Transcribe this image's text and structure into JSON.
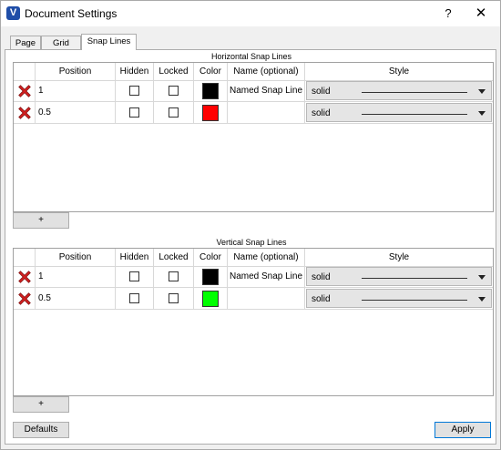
{
  "window": {
    "title": "Document Settings",
    "icon": "V",
    "help_label": "?",
    "close_label": "✕"
  },
  "tabs": [
    {
      "label": "Page",
      "active": false
    },
    {
      "label": "Grid",
      "active": false
    },
    {
      "label": "Snap Lines",
      "active": true
    }
  ],
  "columns": {
    "position": "Position",
    "hidden": "Hidden",
    "locked": "Locked",
    "color": "Color",
    "name": "Name (optional)",
    "style": "Style"
  },
  "horizontal": {
    "title": "Horizontal Snap Lines",
    "rows": [
      {
        "position": "1",
        "hidden": false,
        "locked": false,
        "color": "#000000",
        "name": "Named Snap Line",
        "style": "solid"
      },
      {
        "position": "0.5",
        "hidden": false,
        "locked": false,
        "color": "#ff0000",
        "name": "",
        "style": "solid"
      }
    ],
    "add_label": "+"
  },
  "vertical": {
    "title": "Vertical Snap Lines",
    "rows": [
      {
        "position": "1",
        "hidden": false,
        "locked": false,
        "color": "#000000",
        "name": "Named Snap Line",
        "style": "solid"
      },
      {
        "position": "0.5",
        "hidden": false,
        "locked": false,
        "color": "#00ff00",
        "name": "",
        "style": "solid"
      }
    ],
    "add_label": "+"
  },
  "footer": {
    "defaults_label": "Defaults",
    "apply_label": "Apply"
  }
}
